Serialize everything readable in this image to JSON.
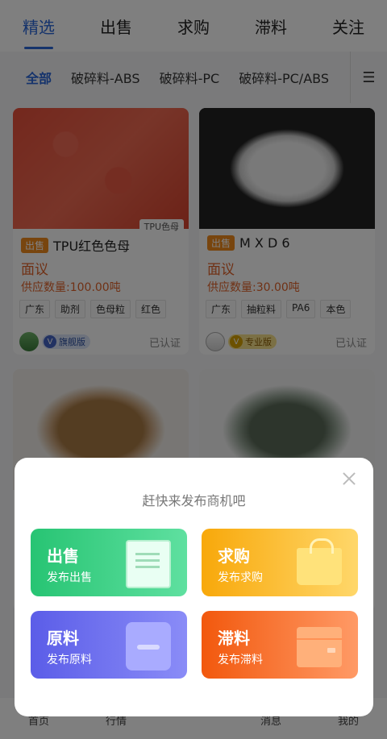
{
  "top_tabs": [
    {
      "label": "精选",
      "active": true
    },
    {
      "label": "出售"
    },
    {
      "label": "求购"
    },
    {
      "label": "滞料"
    },
    {
      "label": "关注"
    }
  ],
  "categories": [
    {
      "label": "全部",
      "active": true
    },
    {
      "label": "破碎料-ABS"
    },
    {
      "label": "破碎料-PC"
    },
    {
      "label": "破碎料-PC/ABS"
    }
  ],
  "category_menu_icon": "☰",
  "products": [
    {
      "image": "red-pellets",
      "image_tag": "TPU色母",
      "badge": "出售",
      "title": "TPU红色色母",
      "price": "面议",
      "quantity": "供应数量:100.00吨",
      "tags": [
        "广东",
        "助剂",
        "色母粒",
        "红色"
      ],
      "level": "旗舰版",
      "verified": "已认证"
    },
    {
      "image": "white-pellets",
      "badge": "出售",
      "title": "M X D 6",
      "price": "面议",
      "quantity": "供应数量:30.00吨",
      "tags": [
        "广东",
        "抽粒料",
        "PA6",
        "本色"
      ],
      "level": "专业版",
      "verified": "已认证"
    },
    {
      "image": "brown-pellets"
    },
    {
      "image": "mixed-flakes"
    }
  ],
  "bottom_nav": [
    "首页",
    "行情",
    "",
    "消息",
    "我的"
  ],
  "publish_sheet": {
    "title": "赶快来发布商机吧",
    "buttons": [
      {
        "label": "出售",
        "sub": "发布出售",
        "icon": "document-icon"
      },
      {
        "label": "求购",
        "sub": "发布求购",
        "icon": "shopping-bag-icon"
      },
      {
        "label": "原料",
        "sub": "发布原料",
        "icon": "jar-icon"
      },
      {
        "label": "滞料",
        "sub": "发布滞料",
        "icon": "box-icon"
      }
    ]
  },
  "colors": {
    "accent": "#2a67d8",
    "price": "#e0632a",
    "sell_green": "#27c473",
    "buy_orange": "#f8a80a",
    "raw_purple": "#5b5de8",
    "slow_red": "#f2580d"
  }
}
